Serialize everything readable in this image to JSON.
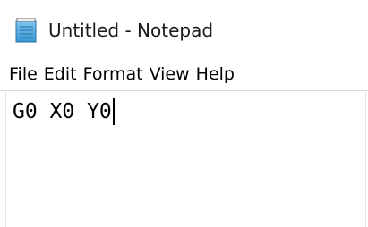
{
  "window": {
    "title": "Untitled - Notepad",
    "icon": "notepad-icon"
  },
  "menu": {
    "items": [
      "File",
      "Edit",
      "Format",
      "View",
      "Help"
    ]
  },
  "editor": {
    "content": "G0 X0 Y0"
  },
  "colors": {
    "background": "#ffffff",
    "text": "#000000",
    "title_text": "#1a1a1a"
  }
}
